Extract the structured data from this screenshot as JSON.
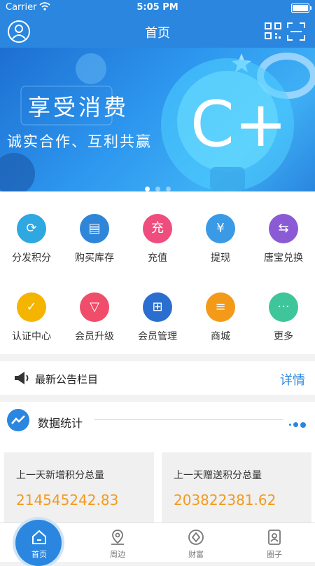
{
  "status": {
    "carrier": "Carrier",
    "time": "5:05 PM"
  },
  "nav": {
    "title": "首页",
    "user_icon": "user-circle-icon",
    "qr_icon": "qr-code-icon",
    "scan_icon": "scan-icon"
  },
  "banner": {
    "slogan_main": "享受消费",
    "slogan_sub": "诚实合作、互利共赢",
    "badge": "C+",
    "pages": 3,
    "active_page": 1
  },
  "menu": [
    {
      "label": "分发积分",
      "icon": "distribute-points-icon",
      "color": "#2fa7e0"
    },
    {
      "label": "购买库存",
      "icon": "stock-icon",
      "color": "#2f86d9"
    },
    {
      "label": "充值",
      "icon": "recharge-icon",
      "color": "#ef4d7e"
    },
    {
      "label": "提现",
      "icon": "withdraw-icon",
      "color": "#3b9ae6"
    },
    {
      "label": "唐宝兑换",
      "icon": "exchange-icon",
      "color": "#8b5bd6"
    },
    {
      "label": "认证中心",
      "icon": "certification-icon",
      "color": "#f5b400"
    },
    {
      "label": "会员升级",
      "icon": "member-upgrade-icon",
      "color": "#ef4d6a"
    },
    {
      "label": "会员管理",
      "icon": "member-manage-icon",
      "color": "#2a6fcf"
    },
    {
      "label": "商城",
      "icon": "mall-icon",
      "color": "#f39a18"
    },
    {
      "label": "更多",
      "icon": "more-icon",
      "color": "#3ec59a"
    }
  ],
  "notice": {
    "text": "最新公告栏目",
    "detail": "详情"
  },
  "stats": {
    "title": "数据统计",
    "cards": [
      {
        "label": "上一天新增积分总量",
        "value": "214545242.83"
      },
      {
        "label": "上一天赠送积分总量",
        "value": "203822381.62"
      }
    ]
  },
  "tabs": [
    {
      "label": "首页",
      "icon": "home-icon",
      "active": true
    },
    {
      "label": "周边",
      "icon": "location-icon",
      "active": false
    },
    {
      "label": "财富",
      "icon": "wealth-icon",
      "active": false
    },
    {
      "label": "圈子",
      "icon": "contacts-icon",
      "active": false
    }
  ],
  "colors": {
    "primary": "#2a86df",
    "value": "#f29a1f"
  }
}
